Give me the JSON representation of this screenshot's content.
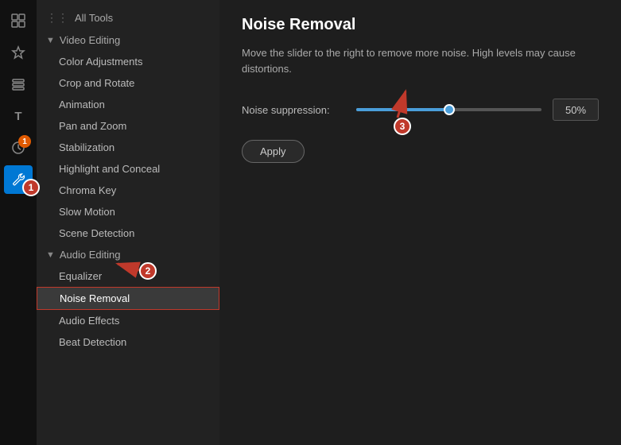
{
  "iconBar": {
    "icons": [
      {
        "name": "grid-icon",
        "symbol": "⊞",
        "active": false,
        "badge": null
      },
      {
        "name": "pin-icon",
        "symbol": "📌",
        "active": false,
        "badge": null
      },
      {
        "name": "layers-icon",
        "symbol": "⧉",
        "active": false,
        "badge": null
      },
      {
        "name": "text-icon",
        "symbol": "T",
        "active": false,
        "badge": null
      },
      {
        "name": "clock-icon",
        "symbol": "◷",
        "active": false,
        "badge": "1"
      },
      {
        "name": "tools-icon",
        "symbol": "🔧",
        "active": true,
        "badge": null
      }
    ]
  },
  "sidebar": {
    "allToolsLabel": "All Tools",
    "videoEditingLabel": "Video Editing",
    "audioEditingLabel": "Audio Editing",
    "items": {
      "video": [
        {
          "label": "Color Adjustments",
          "selected": false
        },
        {
          "label": "Crop and Rotate",
          "selected": false
        },
        {
          "label": "Animation",
          "selected": false
        },
        {
          "label": "Pan and Zoom",
          "selected": false
        },
        {
          "label": "Stabilization",
          "selected": false
        },
        {
          "label": "Highlight and Conceal",
          "selected": false
        },
        {
          "label": "Chroma Key",
          "selected": false
        },
        {
          "label": "Slow Motion",
          "selected": false
        },
        {
          "label": "Scene Detection",
          "selected": false
        }
      ],
      "audio": [
        {
          "label": "Equalizer",
          "selected": false
        },
        {
          "label": "Noise Removal",
          "selected": true
        },
        {
          "label": "Audio Effects",
          "selected": false
        },
        {
          "label": "Beat Detection",
          "selected": false
        }
      ]
    }
  },
  "main": {
    "title": "Noise Removal",
    "description": "Move the slider to the right to remove more noise. High levels may cause distortions.",
    "noiseSuppression": {
      "label": "Noise suppression:",
      "value": "50%",
      "percent": 50
    },
    "applyButton": "Apply"
  },
  "annotations": {
    "badge1": "1",
    "badge2": "2",
    "badge3": "3"
  }
}
